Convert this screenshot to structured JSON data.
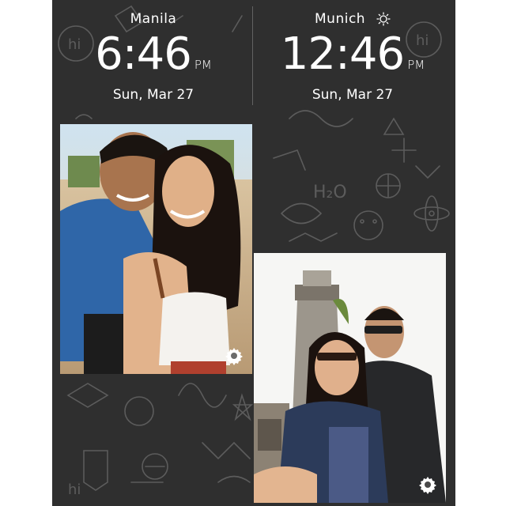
{
  "clocks": [
    {
      "city": "Manila",
      "time": "6:46",
      "ampm": "PM",
      "date": "Sun, Mar 27",
      "weather_icon": null
    },
    {
      "city": "Munich",
      "time": "12:46",
      "ampm": "PM",
      "date": "Sun, Mar 27",
      "weather_icon": "sun-icon"
    }
  ],
  "photos": [
    {
      "subject": "couple selfie on beach at sunset",
      "settings_icon": "gear-icon"
    },
    {
      "subject": "couple selfie in front of lighthouse",
      "settings_icon": "gear-icon"
    }
  ],
  "colors": {
    "board": "#2f2f2f",
    "text": "#ffffff",
    "doodle": "#5a5a5a"
  }
}
